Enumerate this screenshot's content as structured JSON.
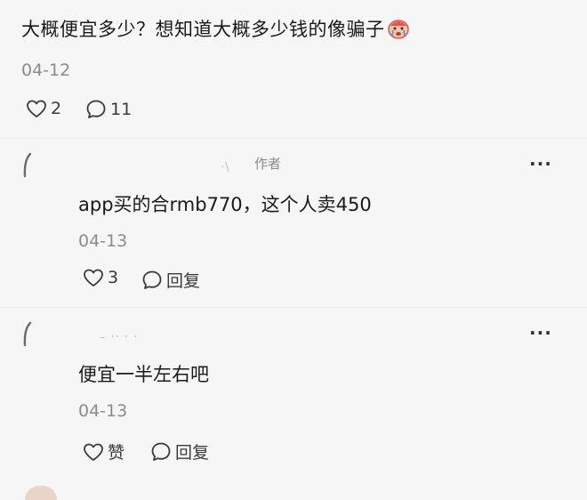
{
  "post": {
    "text": "大概便宜多少？想知道大概多少钱的像骗子",
    "emoji_icon": "crying-face-emoji",
    "date": "04-12",
    "likes": "2",
    "comments": "11"
  },
  "replies": [
    {
      "author_tag": "作者",
      "text": "app买的合rmb770，这个人卖450",
      "date": "04-13",
      "likes": "3",
      "reply_label": "回复"
    },
    {
      "text": "便宜一半左右吧",
      "date": "04-13",
      "likes_label": "赞",
      "reply_label": "回复"
    }
  ],
  "more_label": "···",
  "icons": {
    "like": "heart-outline-icon",
    "comment": "speech-bubble-icon",
    "more": "more-dots-icon",
    "avatar": "user-avatar"
  }
}
